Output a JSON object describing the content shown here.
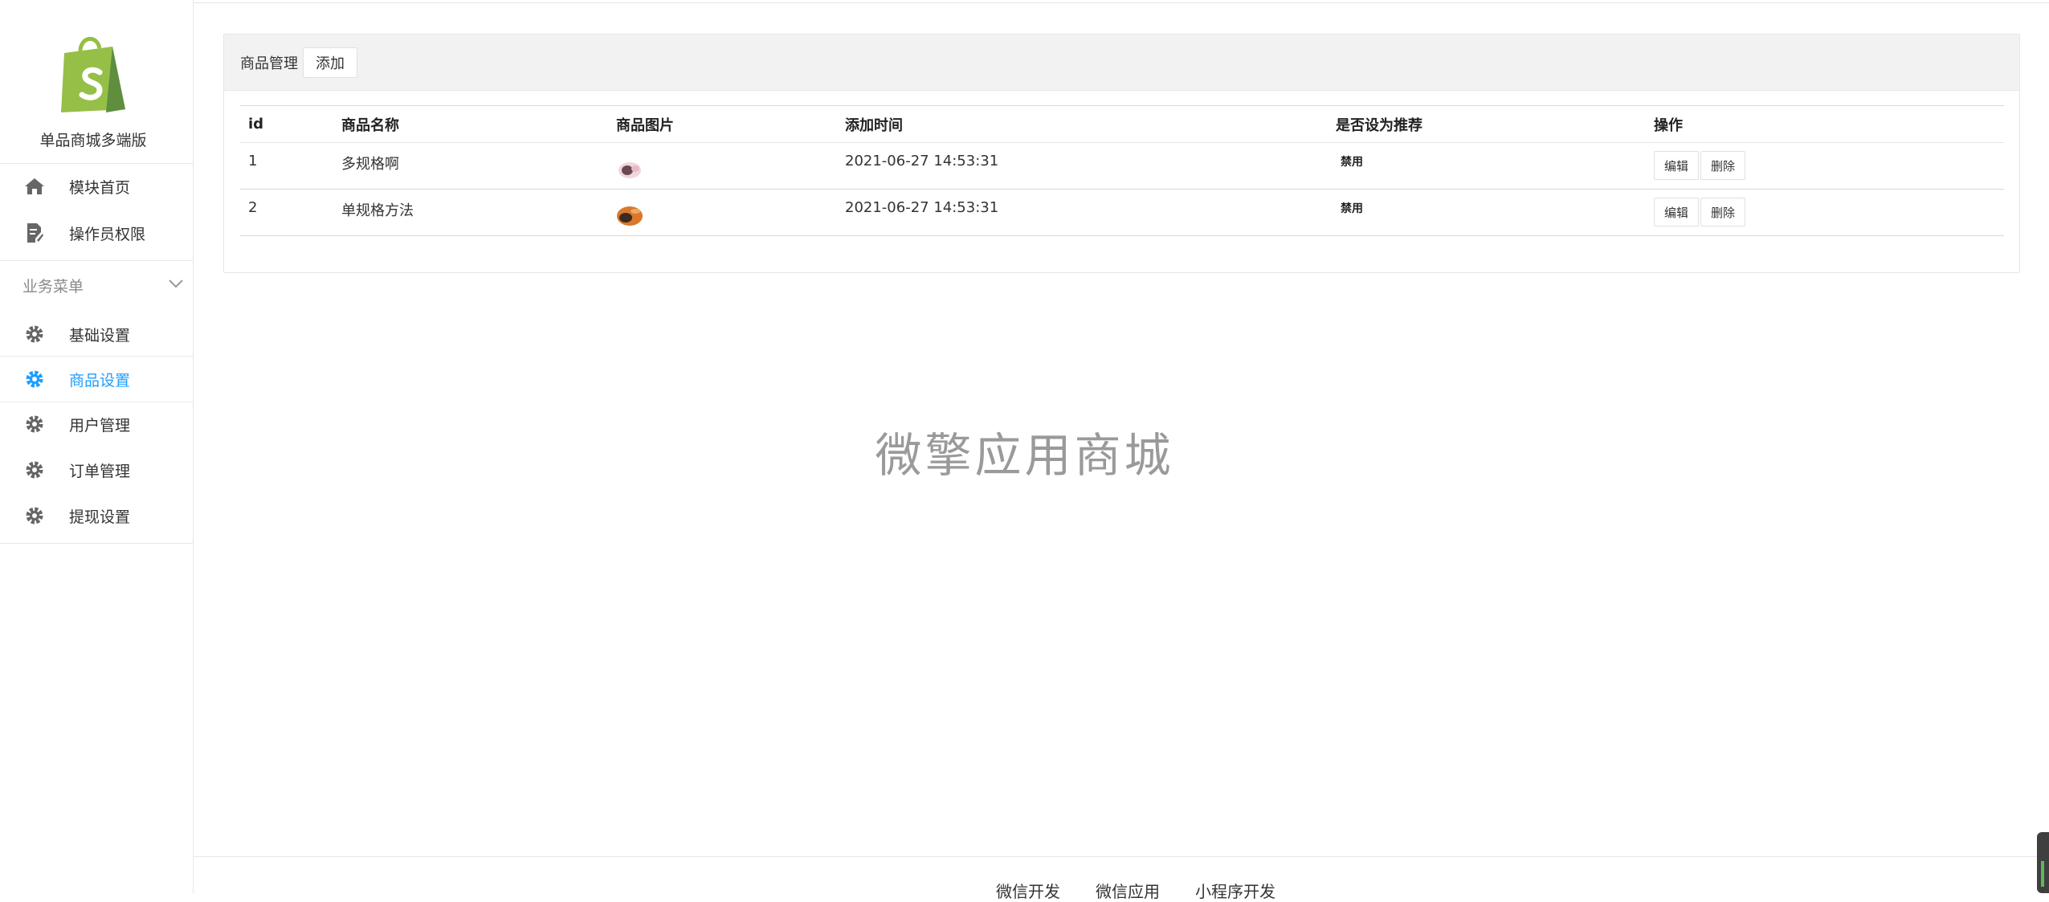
{
  "sidebar": {
    "brand_name": "单品商城多端版",
    "items": [
      {
        "label": "模块首页",
        "icon": "home-icon"
      },
      {
        "label": "操作员权限",
        "icon": "document-edit-icon"
      }
    ],
    "group_title": "业务菜单",
    "group_items": [
      {
        "label": "基础设置",
        "icon": "gear-icon"
      },
      {
        "label": "商品设置",
        "icon": "gear-icon",
        "active": true
      },
      {
        "label": "用户管理",
        "icon": "gear-icon"
      },
      {
        "label": "订单管理",
        "icon": "gear-icon"
      },
      {
        "label": "提现设置",
        "icon": "gear-icon"
      }
    ],
    "accent_color": "#1e9fff",
    "logo_color": "#95bf47"
  },
  "panel": {
    "title": "商品管理",
    "add_label": "添加",
    "columns": [
      "id",
      "商品名称",
      "商品图片",
      "添加时间",
      "是否设为推荐",
      "操作"
    ],
    "rows": [
      {
        "id": "1",
        "name": "多规格啊",
        "added": "2021-06-27 14:53:31",
        "recommend": "禁用"
      },
      {
        "id": "2",
        "name": "单规格方法",
        "added": "2021-06-27 14:53:31",
        "recommend": "禁用"
      }
    ],
    "edit_label": "编辑",
    "delete_label": "删除"
  },
  "watermark": "微擎应用商城",
  "footer": {
    "links": [
      "微信开发",
      "微信应用",
      "小程序开发"
    ]
  }
}
